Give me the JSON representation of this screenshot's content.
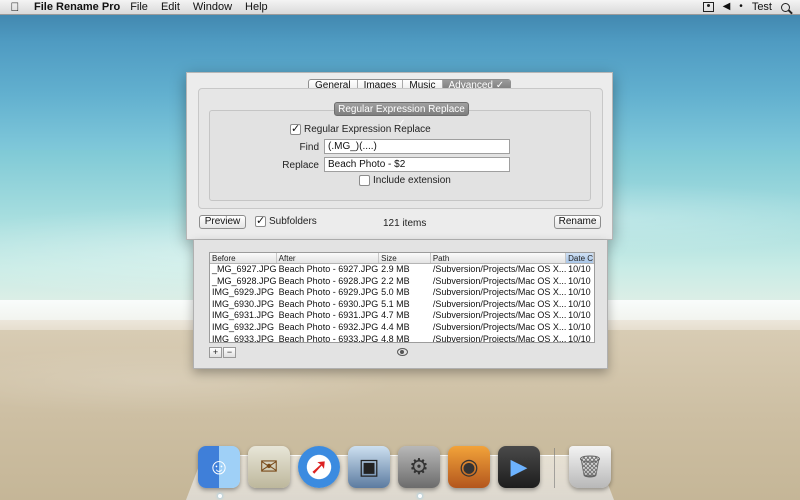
{
  "menubar": {
    "app_name": "File Rename Pro",
    "menus": [
      "File",
      "Edit",
      "Window",
      "Help"
    ],
    "user": "Test"
  },
  "window": {
    "tabs": [
      {
        "label": "General"
      },
      {
        "label": "Images"
      },
      {
        "label": "Music"
      },
      {
        "label": "Advanced ✓"
      }
    ],
    "section_title": "Regular Expression Replace ✓",
    "regex_checkbox_label": "Regular Expression Replace",
    "regex_checked": true,
    "find_label": "Find",
    "find_value": "(.MG_)(....)",
    "replace_label": "Replace",
    "replace_value": "Beach Photo - $2",
    "include_extension_label": "Include extension",
    "include_extension_checked": false,
    "preview_label": "Preview",
    "subfolders_label": "Subfolders",
    "subfolders_checked": true,
    "items_count": "121 items",
    "rename_label": "Rename"
  },
  "table": {
    "columns": [
      "Before",
      "After",
      "Size",
      "Path",
      "Date C"
    ],
    "sorted_column": "Date C",
    "rows": [
      [
        "_MG_6927.JPG",
        "Beach Photo - 6927.JPG",
        "2.9 MB",
        "/Subversion/Projects/Mac OS X...",
        "10/10"
      ],
      [
        "_MG_6928.JPG",
        "Beach Photo - 6928.JPG",
        "2.2 MB",
        "/Subversion/Projects/Mac OS X...",
        "10/10"
      ],
      [
        "IMG_6929.JPG",
        "Beach Photo - 6929.JPG",
        "5.0 MB",
        "/Subversion/Projects/Mac OS X...",
        "10/10"
      ],
      [
        "IMG_6930.JPG",
        "Beach Photo - 6930.JPG",
        "5.1 MB",
        "/Subversion/Projects/Mac OS X...",
        "10/10"
      ],
      [
        "IMG_6931.JPG",
        "Beach Photo - 6931.JPG",
        "4.7 MB",
        "/Subversion/Projects/Mac OS X...",
        "10/10"
      ],
      [
        "IMG_6932.JPG",
        "Beach Photo - 6932.JPG",
        "4.4 MB",
        "/Subversion/Projects/Mac OS X...",
        "10/10"
      ],
      [
        "IMG_6933.JPG",
        "Beach Photo - 6933.JPG",
        "4.8 MB",
        "/Subversion/Projects/Mac OS X...",
        "10/10"
      ]
    ],
    "add_label": "+",
    "remove_label": "−"
  },
  "dock": {
    "items": [
      {
        "icon": "finder-icon",
        "glyph": "☺"
      },
      {
        "icon": "mail-icon",
        "glyph": "✉"
      },
      {
        "icon": "safari-icon",
        "glyph": "➚"
      },
      {
        "icon": "iphoto-icon",
        "glyph": "▣"
      },
      {
        "icon": "system-preferences-icon",
        "glyph": "⚙"
      },
      {
        "icon": "photo-booth-icon",
        "glyph": "◉"
      },
      {
        "icon": "facetime-icon",
        "glyph": "▶"
      }
    ],
    "trash": {
      "icon": "trash-icon",
      "glyph": "🗑"
    }
  }
}
